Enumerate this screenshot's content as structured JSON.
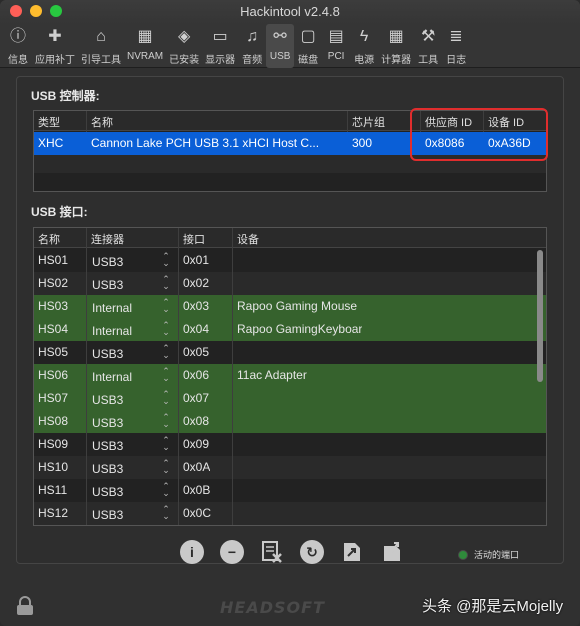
{
  "window": {
    "title": "Hackintool v2.4.8"
  },
  "toolbar": {
    "items": [
      {
        "label": "信息",
        "icon": "info-icon",
        "glyph": "ⓘ"
      },
      {
        "label": "应用补丁",
        "icon": "bandage-icon",
        "glyph": "✚"
      },
      {
        "label": "引导工具",
        "icon": "boot-icon",
        "glyph": "⌂"
      },
      {
        "label": "NVRAM",
        "icon": "chip-icon",
        "glyph": "▦"
      },
      {
        "label": "已安装",
        "icon": "box-icon",
        "glyph": "◈"
      },
      {
        "label": "显示器",
        "icon": "monitor-icon",
        "glyph": "▭"
      },
      {
        "label": "音频",
        "icon": "speaker-icon",
        "glyph": "♫"
      },
      {
        "label": "USB",
        "icon": "usb-icon",
        "glyph": "⚯"
      },
      {
        "label": "磁盘",
        "icon": "disk-icon",
        "glyph": "▢"
      },
      {
        "label": "PCI",
        "icon": "pci-icon",
        "glyph": "▤"
      },
      {
        "label": "电源",
        "icon": "power-icon",
        "glyph": "ϟ"
      },
      {
        "label": "计算器",
        "icon": "calculator-icon",
        "glyph": "▦"
      },
      {
        "label": "工具",
        "icon": "wrench-icon",
        "glyph": "⚒"
      },
      {
        "label": "日志",
        "icon": "log-icon",
        "glyph": "≣"
      }
    ],
    "active_index": 7
  },
  "controllers": {
    "section_label": "USB 控制器:",
    "headers": [
      "类型",
      "名称",
      "芯片组",
      "供应商 ID",
      "设备 ID"
    ],
    "rows": [
      {
        "type": "XHC",
        "name": "Cannon Lake PCH USB 3.1 xHCI Host C...",
        "chipset": "300",
        "vendor_id": "0x8086",
        "device_id": "0xA36D"
      }
    ]
  },
  "ports": {
    "section_label": "USB 接口:",
    "headers": [
      "名称",
      "连接器",
      "接口",
      "设备"
    ],
    "rows": [
      {
        "name": "HS01",
        "connector": "USB3",
        "port": "0x01",
        "device": "",
        "active": false
      },
      {
        "name": "HS02",
        "connector": "USB3",
        "port": "0x02",
        "device": "",
        "active": false
      },
      {
        "name": "HS03",
        "connector": "Internal",
        "port": "0x03",
        "device": "Rapoo Gaming Mouse",
        "active": true
      },
      {
        "name": "HS04",
        "connector": "Internal",
        "port": "0x04",
        "device": "Rapoo GamingKeyboar",
        "active": true
      },
      {
        "name": "HS05",
        "connector": "USB3",
        "port": "0x05",
        "device": "",
        "active": false
      },
      {
        "name": "HS06",
        "connector": "Internal",
        "port": "0x06",
        "device": "11ac Adapter",
        "active": true
      },
      {
        "name": "HS07",
        "connector": "USB3",
        "port": "0x07",
        "device": "",
        "active": true
      },
      {
        "name": "HS08",
        "connector": "USB3",
        "port": "0x08",
        "device": "",
        "active": true
      },
      {
        "name": "HS09",
        "connector": "USB3",
        "port": "0x09",
        "device": "",
        "active": false
      },
      {
        "name": "HS10",
        "connector": "USB3",
        "port": "0x0A",
        "device": "",
        "active": false
      },
      {
        "name": "HS11",
        "connector": "USB3",
        "port": "0x0B",
        "device": "",
        "active": false
      },
      {
        "name": "HS12",
        "connector": "USB3",
        "port": "0x0C",
        "device": "",
        "active": false
      }
    ]
  },
  "bottom": {
    "legend_label": "活动的端口",
    "brand": "HEADSOFT",
    "coffee": "Buy me a Beer",
    "watermark": "头条 @那是云Mojelly"
  },
  "colors": {
    "active_row": "#36622d",
    "selected_row": "#0a5fd7",
    "highlight": "#e02d2d"
  }
}
